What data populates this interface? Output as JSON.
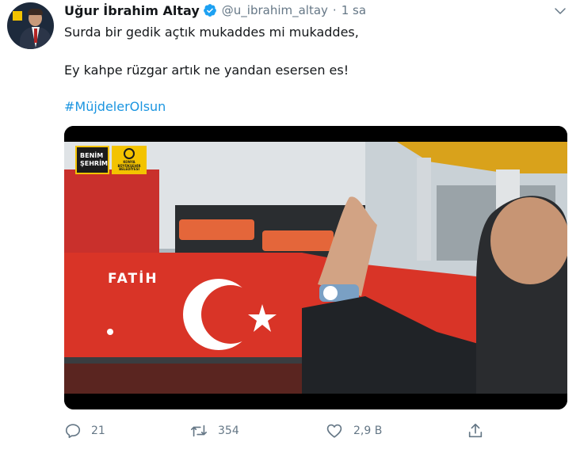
{
  "tweet": {
    "author_name": "Uğur İbrahim Altay",
    "handle": "@u_ibrahim_altay",
    "separator": "·",
    "time": "1 sa",
    "lines": [
      "Surda bir gedik açtık mukaddes mi mukaddes,",
      "Ey kahpe rüzgar artık ne yandan esersen es!"
    ],
    "hashtag": "#MüjdelerOlsun",
    "media": {
      "badge_text": [
        "BENİM",
        "ŞEHRİM"
      ],
      "badge2_text": [
        "KONYA",
        "BÜYÜKŞEHİR",
        "BELEDİYESİ"
      ],
      "ship_name": "FATİH"
    },
    "actions": {
      "reply_count": "21",
      "retweet_count": "354",
      "like_count": "2,9 B"
    }
  },
  "colors": {
    "link": "#1b95e0",
    "secondary_text": "#657786",
    "verified": "#1da1f2",
    "ship_red": "#d93427",
    "badge_yellow": "#f3c300"
  },
  "icons": [
    "chevron-down-icon",
    "verified-badge-icon",
    "reply-icon",
    "retweet-icon",
    "like-icon",
    "share-icon"
  ]
}
